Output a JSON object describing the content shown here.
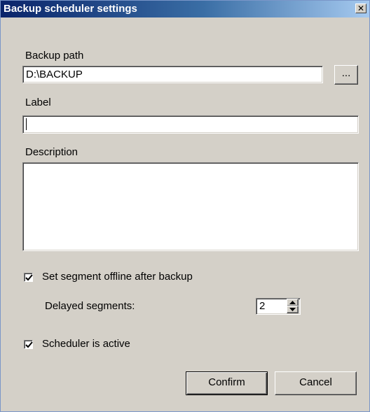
{
  "window": {
    "title": "Backup scheduler settings",
    "close_glyph": "✕"
  },
  "backup_path": {
    "label": "Backup path",
    "value": "D:\\BACKUP",
    "browse_label": "..."
  },
  "label_field": {
    "label": "Label",
    "value": ""
  },
  "description_field": {
    "label": "Description",
    "value": ""
  },
  "offline_option": {
    "label": "Set segment offline after backup",
    "checked": true
  },
  "delayed": {
    "label": "Delayed segments:",
    "value": "2"
  },
  "scheduler_option": {
    "label": "Scheduler is active",
    "checked": true
  },
  "buttons": {
    "confirm": "Confirm",
    "cancel": "Cancel"
  },
  "icons": {
    "close": "close-icon",
    "check": "check-icon",
    "spin_up": "chevron-up-icon",
    "spin_down": "chevron-down-icon"
  }
}
